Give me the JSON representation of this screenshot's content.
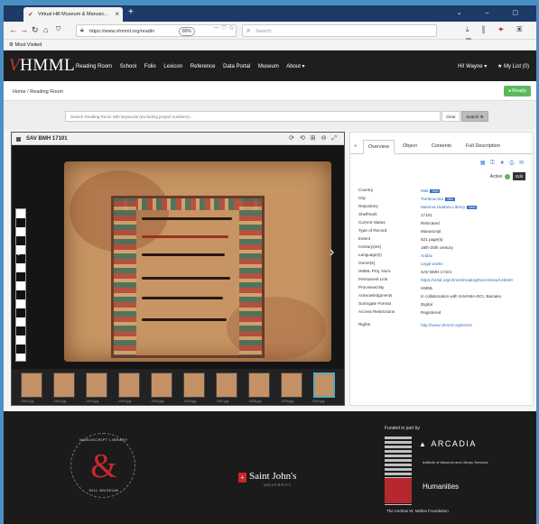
{
  "browser": {
    "tab_title": "Virtual Hill Museum & Manusc...",
    "url": "https://www.vhmml.org/readin",
    "zoom": "80%",
    "search_placeholder": "Search",
    "bookmark": "Most Visited"
  },
  "site": {
    "logo_mark": "V",
    "logo_text": "HMML",
    "nav": [
      "Reading Room",
      "School",
      "Folio",
      "Lexicon",
      "Reference",
      "Data Portal",
      "Museum",
      "About ▾"
    ],
    "user": "Hi! Wayne ▾",
    "mylist": "★ My List (0)"
  },
  "breadcrumb": "Home / Reading Room",
  "ready_button": "◂ Ready",
  "reading_room": {
    "search_placeholder": "Search Reading Room with keywords (excluding project numbers)...",
    "clear": "Clear",
    "search": "Search ⚙"
  },
  "viewer": {
    "title": "SAV BMH 17101",
    "controls": "⟳ ⟲ ⊞ ⊖ ⤢",
    "thumbnails": [
      "...0001.jpg",
      "...0002.jpg",
      "...0003.jpg",
      "...0004.jpg",
      "...0005.jpg",
      "...0006.jpg",
      "...0007.jpg",
      "...0008.jpg",
      "...0009.jpg",
      "...0010.jpg"
    ]
  },
  "info": {
    "tabs": [
      "Overview",
      "Object",
      "Contents",
      "Full Description"
    ],
    "active_label": "Active",
    "edit_label": "Edit",
    "fields": [
      {
        "k": "Country",
        "v": "Mali",
        "link": true,
        "badge": "view"
      },
      {
        "k": "City",
        "v": "Tombouctou",
        "link": true,
        "badge": "view"
      },
      {
        "k": "Repository",
        "v": "Mamma Haidara Library",
        "link": true,
        "badge": "view"
      },
      {
        "k": "Shelfmark",
        "v": "17101",
        "link": false
      },
      {
        "k": "Current Status",
        "v": "Relocated",
        "link": false
      },
      {
        "k": "Type of Record",
        "v": "Manuscript",
        "link": false
      },
      {
        "k": "Extent",
        "v": "621 page(s)",
        "link": false
      },
      {
        "k": "Century(ies)",
        "v": "18th-20th century",
        "link": false
      },
      {
        "k": "Language(s)",
        "v": "Arabic",
        "link": true
      },
      {
        "k": "Genre(s)",
        "v": "Legal works",
        "link": true
      },
      {
        "k": "HMML Proj. Num.",
        "v": "SAV BMH 17101",
        "link": false
      },
      {
        "k": "Permanent Link",
        "v": "https://w3id.org/vhmml/readingRoom/view/146530",
        "link": true
      },
      {
        "k": "Processed By",
        "v": "HMML",
        "link": false
      },
      {
        "k": "Acknowledgments",
        "v": "In collaboration with SAVAMA-DCI, Bamako",
        "link": false
      },
      {
        "k": "Surrogate Format",
        "v": "Digital",
        "link": false
      },
      {
        "k": "Access Restrictions",
        "v": "Registered",
        "link": false,
        "tall": true
      },
      {
        "k": "Rights",
        "v": "http://www.vhmml.org/terms",
        "link": true
      }
    ]
  },
  "footer": {
    "seal_top": "MANUSCRIPT LIBRARY",
    "seal_bottom": "HILL MUSEUM",
    "sj_name": "Saint John's",
    "sj_sub": "UNIVERSITY",
    "funded": "Funded in part by",
    "arcadia": "ARCADIA",
    "imls": "Institute of Museum and Library Services",
    "neh": "Humanities",
    "mellon": "The Andrew W. Mellon Foundation"
  },
  "colors": {
    "accent_red": "#c8282d",
    "link_blue": "#2f6fbf",
    "header_bg": "#1e1e1e",
    "ready_green": "#5cb85c"
  }
}
